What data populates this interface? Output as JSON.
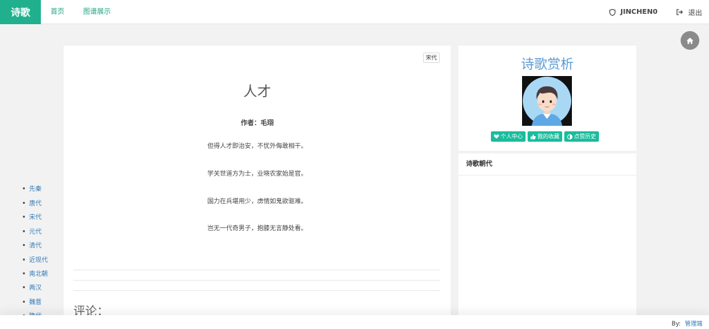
{
  "nav": {
    "brand": "诗歌",
    "home": "首页",
    "graph": "图谱展示",
    "user": "JINCHEN0",
    "logout": "退出"
  },
  "poem": {
    "dynasty": "宋代",
    "title": "人才",
    "author": "作者：毛珝",
    "lines": [
      "但得人才即治安，不忧外侮敢相干。",
      "学关世道方为士，业晓农家始是官。",
      "国力在兵堪用少，虏情如鬼欲驱难。",
      "岂无一代奇男子，抱膝无言静处看。"
    ],
    "comments_title": "评论："
  },
  "sidebar": {
    "title": "诗歌赏析",
    "buttons": [
      "个人中心",
      "我的收藏",
      "点赞历史"
    ],
    "dynasty_header": "诗歌朝代",
    "dynasties": [
      "先秦",
      "唐代",
      "宋代",
      "元代",
      "清代",
      "近现代",
      "南北朝",
      "两汉",
      "魏晋",
      "隋代"
    ]
  },
  "footer": {
    "by": "By:",
    "admin": "管理端"
  },
  "colors": {
    "brand": "#20b08d",
    "title_blue": "#5b9bd5",
    "button": "#1abc9c",
    "link": "#337ab7"
  }
}
